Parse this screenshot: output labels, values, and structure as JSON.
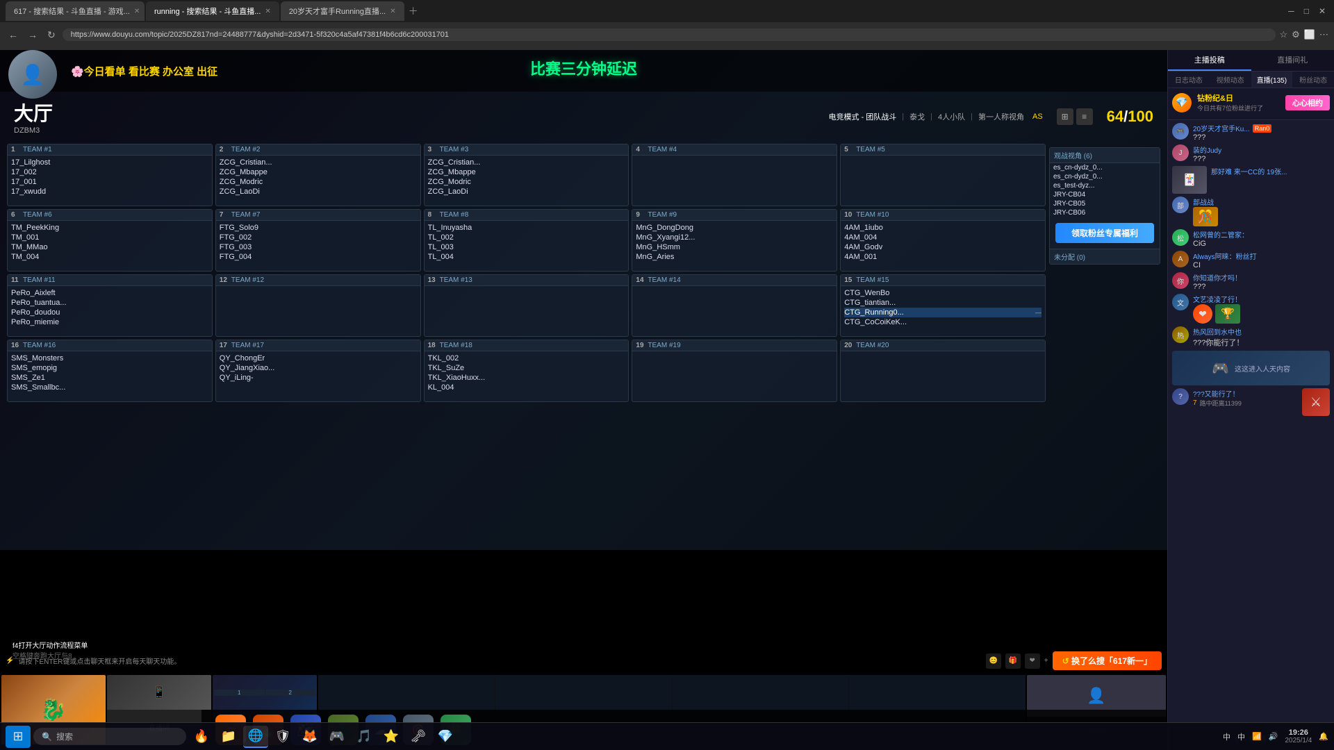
{
  "browser": {
    "tabs": [
      {
        "label": "617 - 搜索结果 - 斗鱼直播 - 游戏...",
        "active": false
      },
      {
        "label": "running - 搜索结果 - 斗鱼直播...",
        "active": true
      },
      {
        "label": "20岁天才富手Running直播...",
        "active": false
      }
    ],
    "url": "https://www.douyu.com/topic/2025DZ817nd=24488777&dyshid=2d3471-5f320c4a5af47381f4b6cd6c200031701"
  },
  "stream": {
    "title": "大厅",
    "subtitle": "DZBM3",
    "player_count": "64",
    "player_max": "100",
    "delay_notice": "比赛三分钟延迟",
    "banner": "🌸今日看单 看比赛 办公室 出征",
    "mode": "电竞模式 - 团队战斗",
    "mode_extra": "泰戈",
    "mode_team": "4人小队",
    "mode_view": "第一人称视角",
    "mode_tag": "AS"
  },
  "teams": [
    {
      "num": 1,
      "name": "TEAM #1",
      "players": [
        "17_Lilghost",
        "17_002",
        "17_001",
        "17_xwudd"
      ]
    },
    {
      "num": 2,
      "name": "TEAM #2",
      "players": [
        "ZCG_Cristian...",
        "ZCG_Mbappe",
        "ZCG_Modric",
        "ZCG_LaoDi"
      ]
    },
    {
      "num": 3,
      "name": "TEAM #3",
      "players": [
        "ZCG_Cristian...",
        "ZCG_Mbappe",
        "ZCG_Modric",
        "ZCG_LaoDi"
      ]
    },
    {
      "num": 4,
      "name": "TEAM #4",
      "players": []
    },
    {
      "num": 5,
      "name": "TEAM #5",
      "players": []
    },
    {
      "num": 6,
      "name": "TEAM #6",
      "players": [
        "TM_PeekKing",
        "TM_001",
        "TM_MMao",
        "TM_004"
      ]
    },
    {
      "num": 7,
      "name": "TEAM #7",
      "players": [
        "FTG_Solo9",
        "FTG_002",
        "FTG_003",
        "FTG_004"
      ]
    },
    {
      "num": 8,
      "name": "TEAM #8",
      "players": [
        "TL_Inuyasha",
        "TL_002",
        "TL_003",
        "TL_004"
      ]
    },
    {
      "num": 9,
      "name": "TEAM #9",
      "players": [
        "MnG_DongDong",
        "MnG_Xyangi12...",
        "MnG_HSmm",
        "MnG_Aries"
      ]
    },
    {
      "num": 10,
      "name": "TEAM #10",
      "players": [
        "4AM_1iubo",
        "4AM_004",
        "4AM_Godv",
        "4AM_001"
      ]
    },
    {
      "num": 11,
      "name": "TEAM #11",
      "players": [
        "PeRo_Aixleft",
        "PeRo_tuantua...",
        "PeRo_doudou",
        "PeRo_miemie"
      ]
    },
    {
      "num": 12,
      "name": "TEAM #12",
      "players": []
    },
    {
      "num": 13,
      "name": "TEAM #13",
      "players": []
    },
    {
      "num": 14,
      "name": "TEAM #14",
      "players": []
    },
    {
      "num": 15,
      "name": "TEAM #15",
      "players": [
        "CTG_WenBo",
        "CTG_tiantian...",
        "CTG_Running0...",
        "CTG_CoCoiKeK..."
      ]
    },
    {
      "num": 16,
      "name": "TEAM #16",
      "players": [
        "SMS_Monsters",
        "SMS_emopig",
        "SMS_Ze1",
        "SMS_Smallbc..."
      ]
    },
    {
      "num": 17,
      "name": "TEAM #17",
      "players": [
        "QY_ChongEr",
        "QY_JiangXiao...",
        "QY_iLing-"
      ]
    },
    {
      "num": 18,
      "name": "TEAM #18",
      "players": [
        "TKL_002",
        "TKL_SuZe",
        "TKL_XiaoHuxx...",
        "KL_004"
      ]
    },
    {
      "num": 19,
      "name": "TEAM #19",
      "players": []
    },
    {
      "num": 20,
      "name": "TEAM #20",
      "players": []
    }
  ],
  "spectators": {
    "title": "观战视角 (6)",
    "players": [
      "es_cn-dydz_0...",
      "es_cn-dydz_0...",
      "es_test-dyz...",
      "JRY-CB04",
      "JRY-CB05",
      "JRY-CB06"
    ],
    "fan_btn": "领取粉丝专属福利",
    "unassigned": "未分配 (0)"
  },
  "sidebar": {
    "tabs": [
      "主播投稿",
      "直播间礼"
    ],
    "sub_tabs": [
      "日志动态",
      "视频动态",
      "直播(135)",
      "粉丝动态"
    ],
    "active_tab": 0,
    "active_sub_tab": 2,
    "fan_label": "钻粉纪&日",
    "fan_sub": "今日共有7位粉丝进行了",
    "pink_btn": "心心相约",
    "chat_messages": [
      {
        "user": "20岁天才宫手Ku...",
        "badge": "Ran0",
        "text": "???"
      },
      {
        "user": "装的Judy",
        "badge": "",
        "text": "???"
      },
      {
        "user": "那好难 来一CC的 19张...",
        "badge": "",
        "text": "..."
      },
      {
        "user": "部战战",
        "badge": "",
        "text": ""
      },
      {
        "user": "松网曾的二管家：",
        "badge": "",
        "text": ""
      },
      {
        "user": "Always阿睐：粉丝打",
        "badge": "",
        "text": ""
      },
      {
        "user": "你知道你才吗！",
        "badge": "",
        "text": ""
      },
      {
        "user": "文艺凌凌了行！",
        "badge": "",
        "text": ""
      },
      {
        "user": "热风回到水中也",
        "badge": "",
        "text": ""
      },
      {
        "user": "???你能行了！",
        "badge": "",
        "text": ""
      }
    ]
  },
  "popup": {
    "line1": "f4打开大厅动作流程菜单",
    "line2": "空格键奔跑大厅与8"
  },
  "cta_btn": "换了么搜「617新一」",
  "chat_placeholder": "请按下ENTER键或点击聊天框来开启每天聊天功能。",
  "taskbar": {
    "search_placeholder": "搜索",
    "time": "19:26",
    "date": "2025/1/4",
    "apps": [
      "🪟",
      "🔥",
      "📁",
      "🌐",
      "🏹",
      "🛡",
      "🎯",
      "🦊",
      "🎮",
      "🎵",
      "🎨"
    ]
  }
}
